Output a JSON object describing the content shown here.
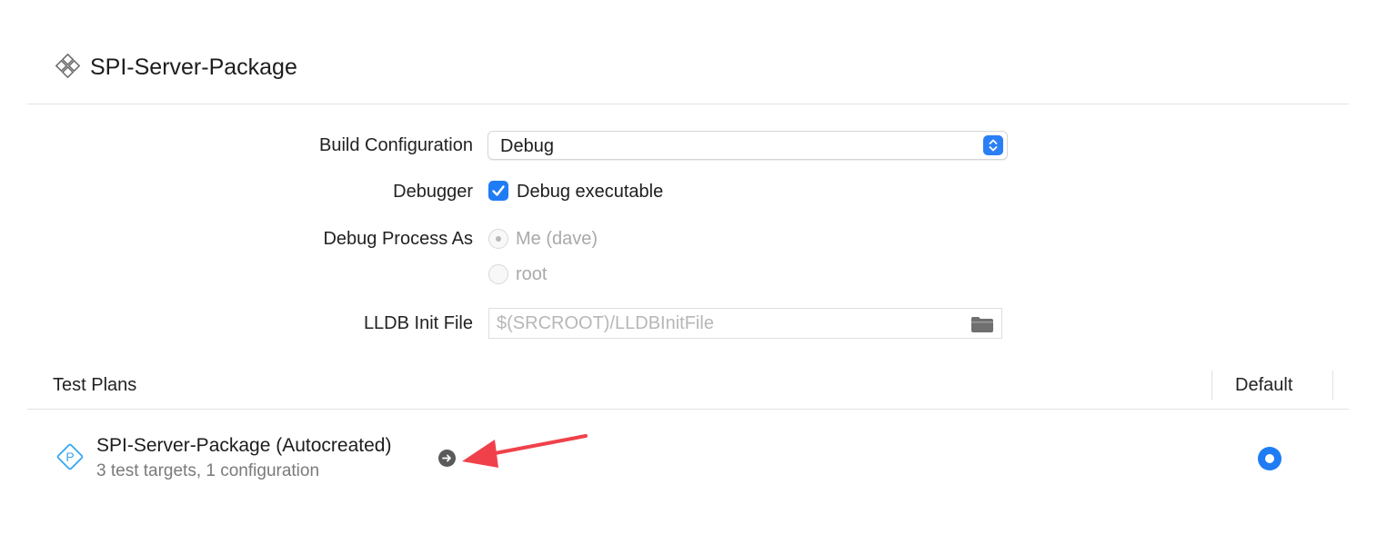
{
  "header": {
    "title": "SPI-Server-Package",
    "icon": "package-icon"
  },
  "form": {
    "build_configuration": {
      "label": "Build Configuration",
      "value": "Debug"
    },
    "debugger": {
      "label": "Debugger",
      "checkbox_label": "Debug executable",
      "checked": true
    },
    "debug_process_as": {
      "label": "Debug Process As",
      "options": [
        {
          "label": "Me (dave)",
          "selected": true,
          "enabled": false
        },
        {
          "label": "root",
          "selected": false,
          "enabled": false
        }
      ]
    },
    "lldb_init_file": {
      "label": "LLDB Init File",
      "value": "",
      "placeholder": "$(SRCROOT)/LLDBInitFile",
      "icon": "folder-icon"
    }
  },
  "test_plans": {
    "columns": [
      "Test Plans",
      "Default"
    ],
    "rows": [
      {
        "title": "SPI-Server-Package (Autocreated)",
        "subtitle": "3 test targets, 1 configuration",
        "icon": "test-plan-icon",
        "is_default": true
      }
    ]
  },
  "colors": {
    "accent": "#1f7cf4",
    "annotation_arrow": "#f0414b"
  }
}
